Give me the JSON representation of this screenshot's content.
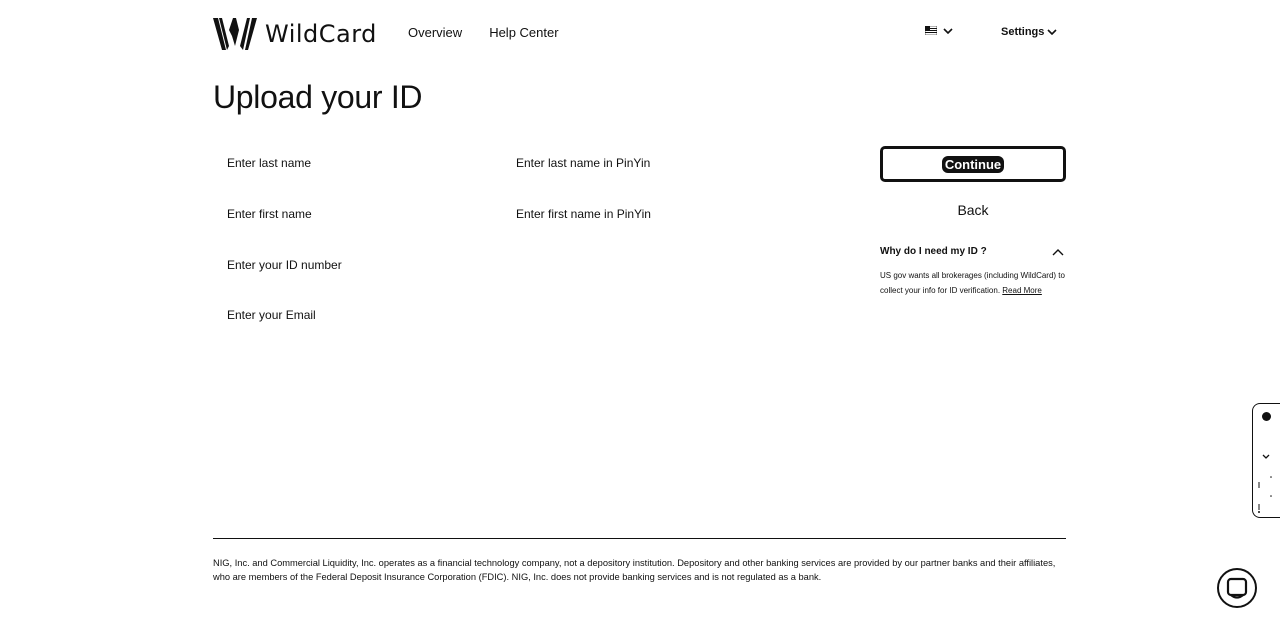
{
  "header": {
    "brand": "WildCard",
    "nav": [
      "Overview",
      "Help Center"
    ],
    "language_icon": "us-flag-icon",
    "settings_label": "Settings"
  },
  "page": {
    "title": "Upload your ID"
  },
  "form": {
    "last_name_placeholder": "Enter last name",
    "last_name_pinyin_placeholder": "Enter last name in PinYin",
    "first_name_placeholder": "Enter first name",
    "first_name_pinyin_placeholder": "Enter first name in PinYin",
    "id_number_placeholder": "Enter your ID number",
    "email_placeholder": "Enter your Email"
  },
  "actions": {
    "continue_label": "Continue",
    "back_label": "Back"
  },
  "why": {
    "title": "Why do I need my ID ?",
    "body": "US gov wants all brokerages (including WildCard) to collect your info for ID verification.",
    "read_more": "Read More"
  },
  "footer": {
    "disclaimer": "NIG, Inc. and Commercial Liquidity, Inc. operates as a financial technology company, not a depository institution. Depository and other banking services are provided by our partner banks and their affiliates, who are members of the Federal Deposit Insurance Corporation (FDIC). NIG, Inc. does not provide banking services and is not regulated as a bank."
  },
  "colors": {
    "text": "#111111",
    "background": "#ffffff"
  }
}
